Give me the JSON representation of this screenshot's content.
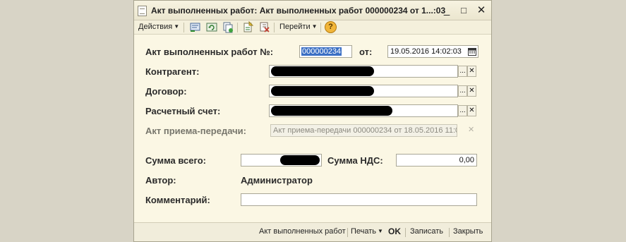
{
  "window": {
    "title": "Акт выполненных работ: Акт выполненных работ 000000234 от 1...:03",
    "minimize": "_",
    "maximize": "□",
    "close": "✕"
  },
  "toolbar": {
    "actions_label": "Действия",
    "goto_label": "Перейти",
    "icons": [
      "post-icon",
      "refresh-icon",
      "copy-icon",
      "create-based-icon",
      "structure-icon",
      "help-icon"
    ],
    "help_glyph": "?"
  },
  "form": {
    "doc_label": "Акт выполненных работ №:",
    "doc_number": "000000234",
    "date_label": "от:",
    "date_value": "19.05.2016 14:02:03",
    "contractor_label": "Контрагент:",
    "contract_label": "Договор:",
    "account_label": "Расчетный счет:",
    "transfer_label": "Акт приема-передачи:",
    "transfer_value": "Акт приема-передачи 000000234 от 18.05.2016 11:0",
    "sum_label": "Сумма всего:",
    "vat_label": "Сумма НДС:",
    "vat_value": "0,00",
    "author_label": "Автор:",
    "author_value": "Администратор",
    "comment_label": "Комментарий:",
    "comment_value": "",
    "select_glyph": "...",
    "clear_glyph": "✕"
  },
  "footer": {
    "doc_link": "Акт выполненных работ",
    "print": "Печать",
    "ok": "OK",
    "save": "Записать",
    "close": "Закрыть"
  },
  "colors": {
    "window_bg": "#fbf7e4",
    "desktop_bg": "#d9d5c7",
    "selection": "#3b6fc4"
  }
}
